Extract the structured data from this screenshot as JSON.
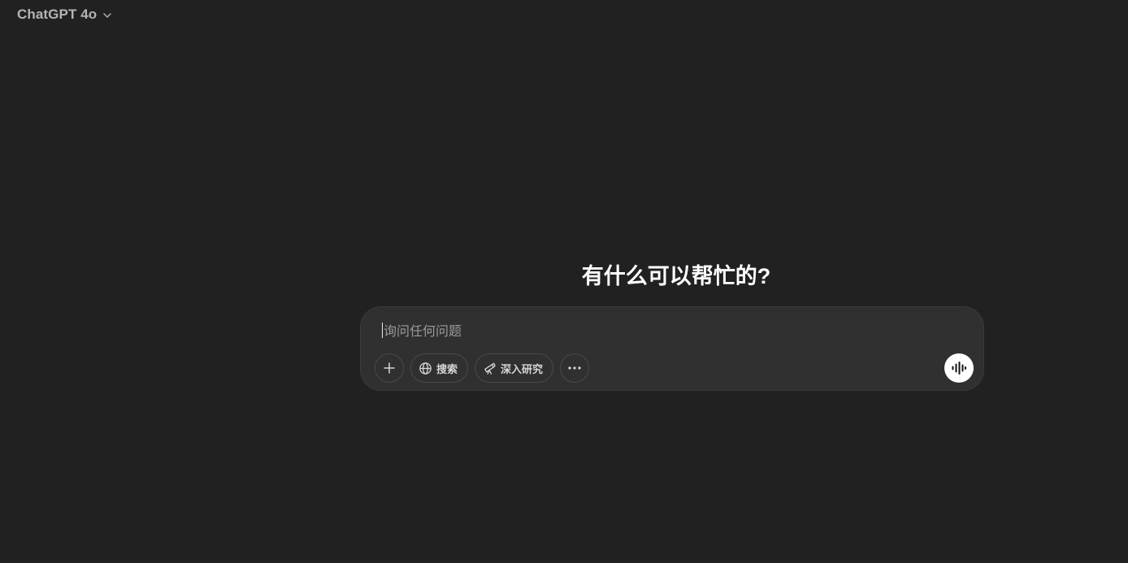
{
  "header": {
    "model_name": "ChatGPT 4o",
    "chevron_icon": "chevron-down-icon"
  },
  "main": {
    "headline": "有什么可以帮忙的?"
  },
  "composer": {
    "placeholder": "询问任何问题",
    "tools": {
      "attach_icon": "plus-icon",
      "search_label": "搜索",
      "search_icon": "globe-icon",
      "research_label": "深入研究",
      "research_icon": "telescope-icon",
      "more_icon": "ellipsis-icon"
    },
    "voice_icon": "voice-waveform-icon"
  },
  "colors": {
    "background": "#212121",
    "composer_bg": "#303030",
    "text_primary": "#ffffff",
    "text_muted": "#9a9a9a",
    "button_border": "#4a4a4a",
    "voice_button_bg": "#ffffff"
  }
}
